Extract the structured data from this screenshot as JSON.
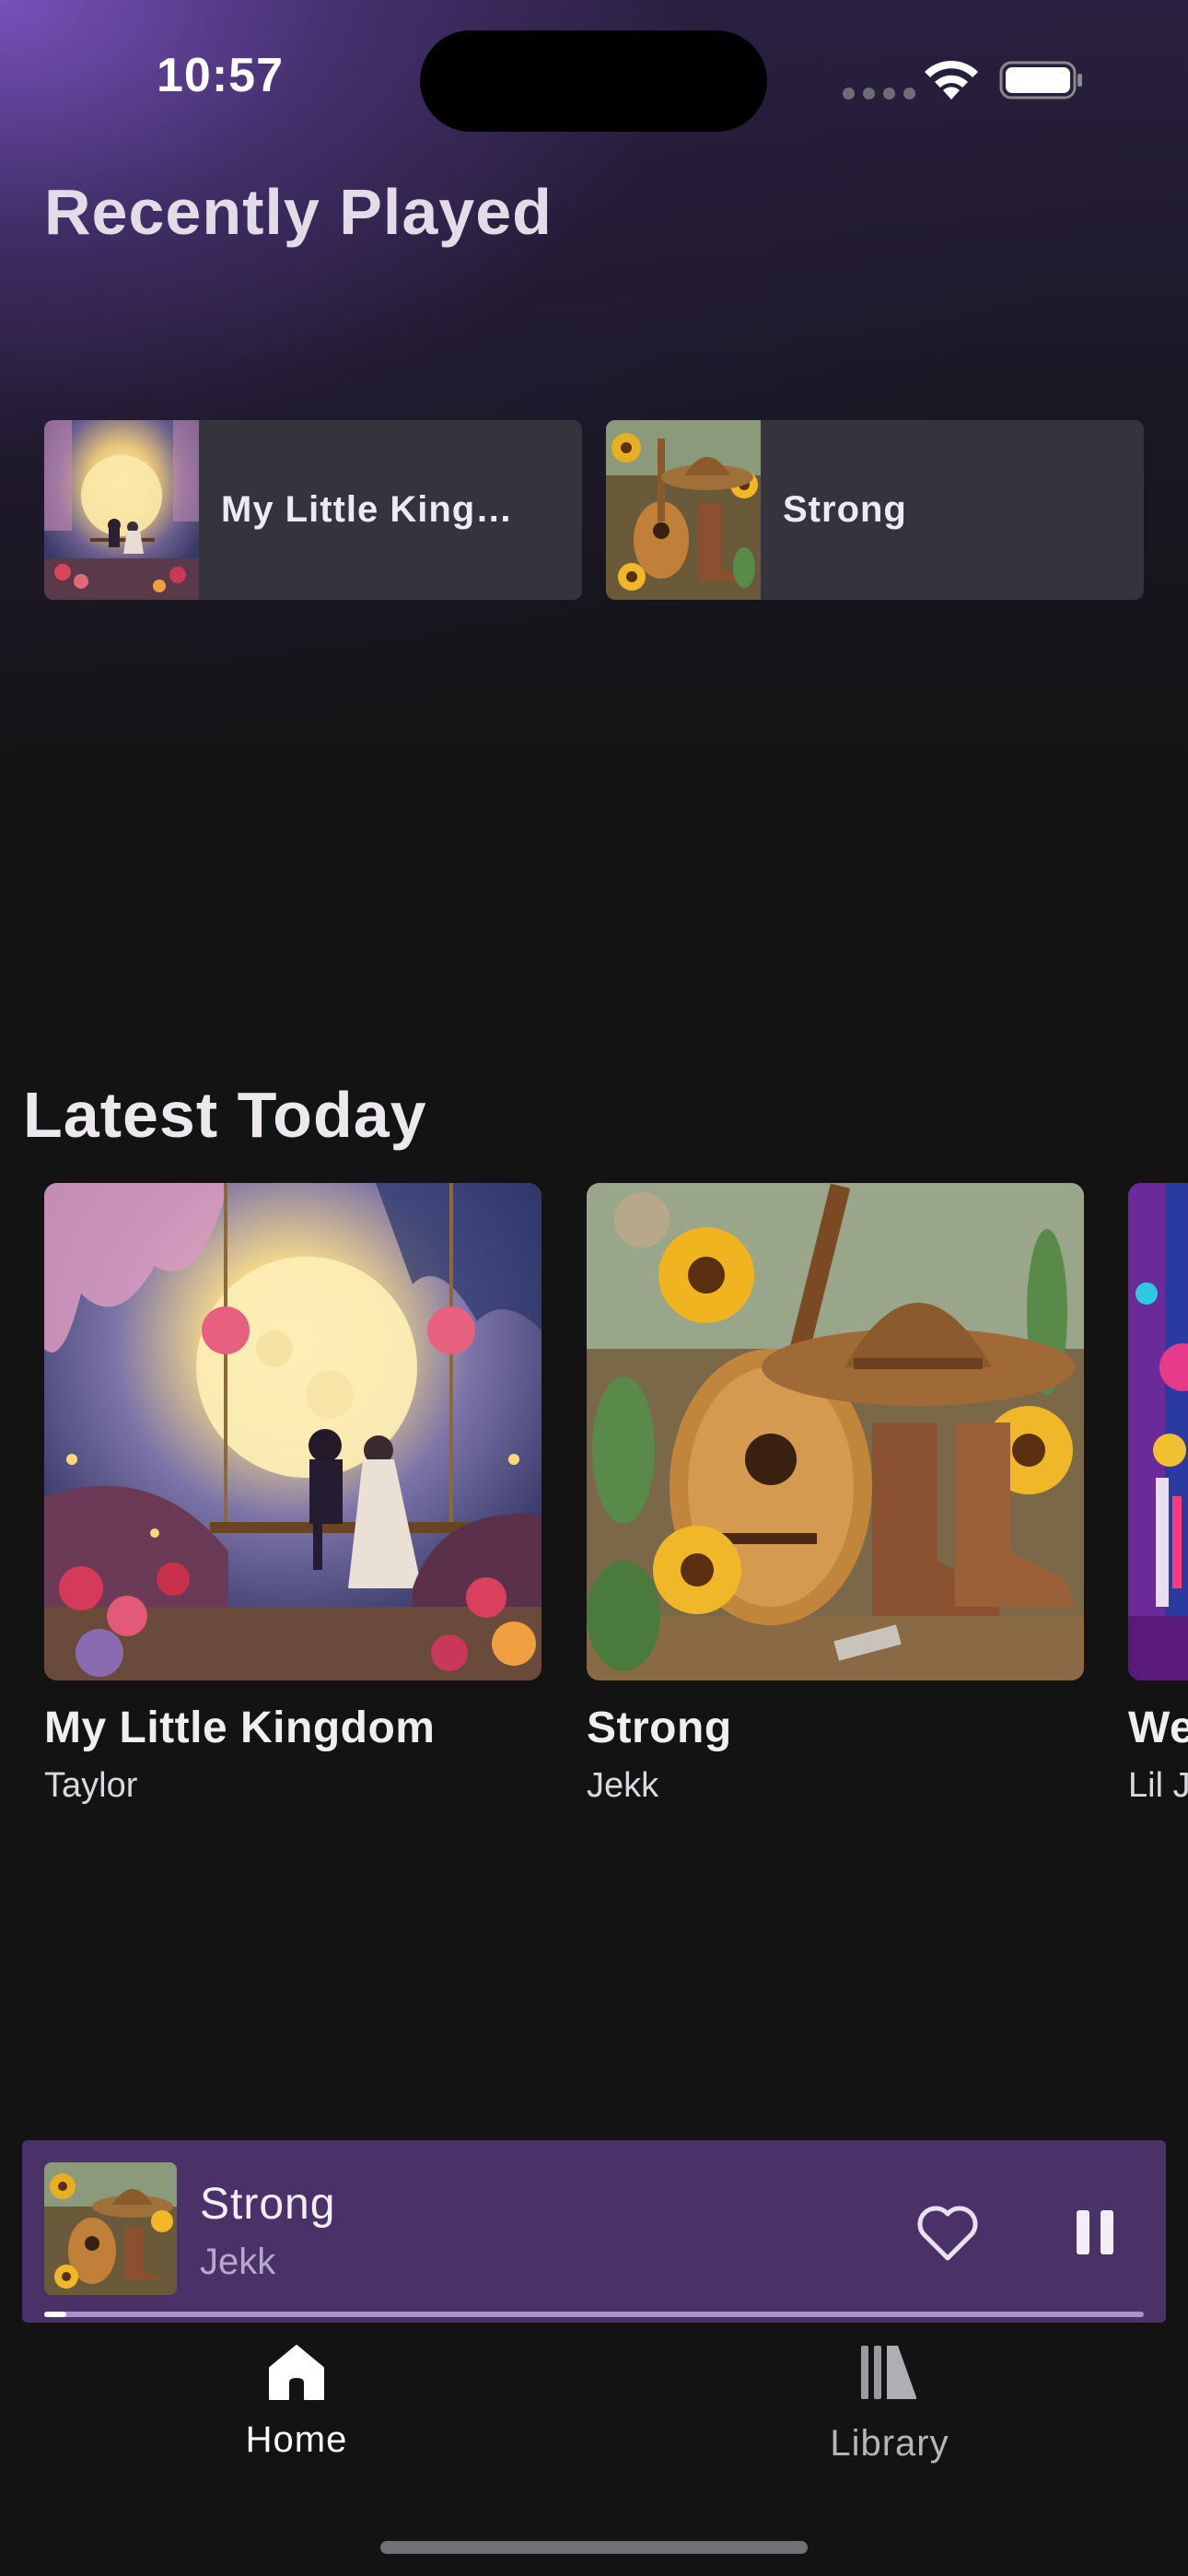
{
  "status_bar": {
    "time": "10:57"
  },
  "recently_played": {
    "title": "Recently Played",
    "items": [
      {
        "label": "My Little Kingdom",
        "art": "moonlit-swing-artwork"
      },
      {
        "label": "Strong",
        "art": "cowboy-guitar-artwork"
      }
    ]
  },
  "latest_today": {
    "title": "Latest Today",
    "items": [
      {
        "title": "My Little Kingdom",
        "artist": "Taylor",
        "art": "moonlit-swing-artwork"
      },
      {
        "title": "Strong",
        "artist": "Jekk",
        "art": "cowboy-guitar-artwork"
      },
      {
        "title": "We",
        "artist": "Lil J",
        "art": "colorful-abstract-artwork"
      }
    ]
  },
  "mini_player": {
    "title": "Strong",
    "artist": "Jekk",
    "progress": 0.02,
    "like_icon": "heart-outline-icon",
    "playback_icon": "pause-icon",
    "background_color": "#4a3268"
  },
  "bottom_nav": {
    "items": [
      {
        "label": "Home",
        "icon": "home-icon",
        "active": true
      },
      {
        "label": "Library",
        "icon": "library-icon",
        "active": false
      }
    ]
  }
}
